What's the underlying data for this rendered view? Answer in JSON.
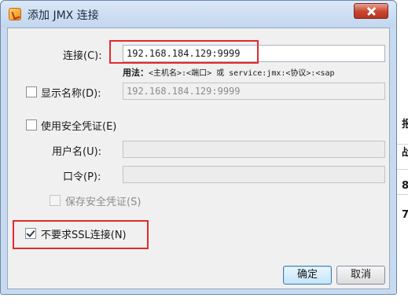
{
  "window": {
    "title": "添加 JMX 连接"
  },
  "form": {
    "connection": {
      "label": "连接(C):",
      "value": "192.168.184.129:9999"
    },
    "hint": {
      "strong": "用法：",
      "rest": "<主机名>:<端口> 或 service:jmx:<协议>:<sap"
    },
    "display_name": {
      "label": "显示名称(D):",
      "checked": false,
      "value": "192.168.184.129:9999"
    },
    "use_credentials": {
      "label": "使用安全凭证(E)",
      "checked": false
    },
    "username": {
      "label": "用户名(U):",
      "value": ""
    },
    "password": {
      "label": "口令(P):",
      "value": ""
    },
    "save_credentials": {
      "label": "保存安全凭证(S)",
      "checked": false
    },
    "no_ssl": {
      "label": "不要求SSL连接(N)",
      "checked": true
    }
  },
  "buttons": {
    "ok_label": "确定",
    "cancel_label": "取消"
  },
  "background_window": {
    "chars": [
      "报",
      "战",
      "8",
      "7"
    ]
  },
  "colors": {
    "highlight": "#e02b2b",
    "titlebar": "#c7daf0",
    "close_button": "#c8442c"
  },
  "icons": {
    "app": "java-app-icon",
    "close": "close-icon",
    "check": "check-icon"
  }
}
